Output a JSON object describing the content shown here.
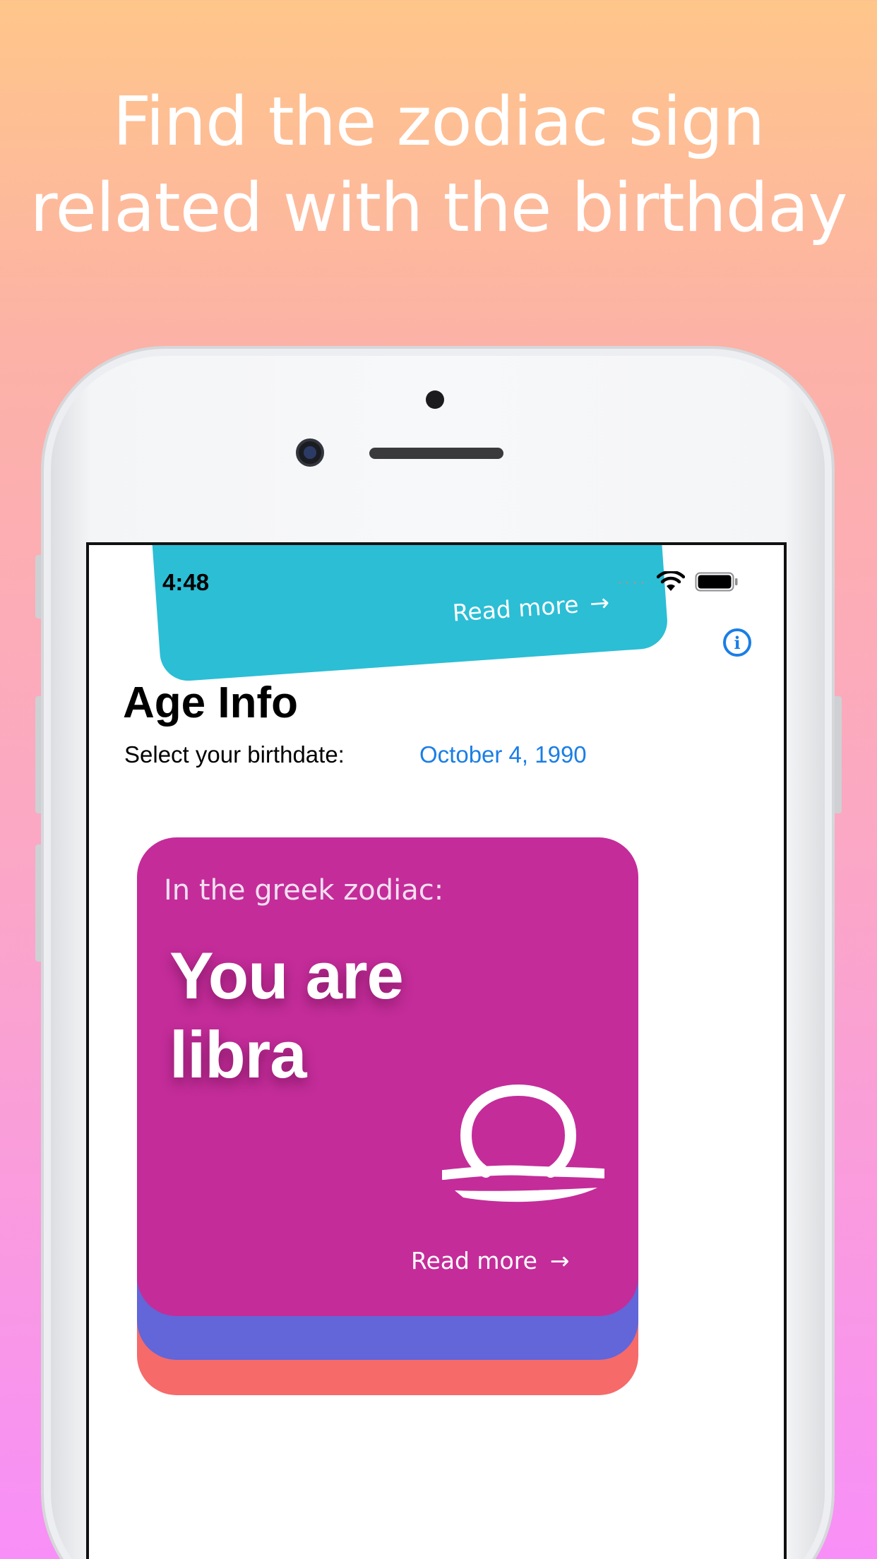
{
  "promo": {
    "headline_line1": "Find the zodiac sign",
    "headline_line2": "related with the birthday"
  },
  "status_bar": {
    "time": "4:48"
  },
  "teal_card": {
    "read_more": "Read more"
  },
  "app": {
    "title": "Age Info",
    "birthdate_label": "Select your birthdate:",
    "birthdate_value": "October 4, 1990"
  },
  "zodiac_card": {
    "subtitle": "In the greek zodiac:",
    "headline_line1": "You are",
    "headline_line2": "libra",
    "read_more": "Read more",
    "icon": "libra-icon"
  },
  "colors": {
    "accent_blue": "#1a7ee6",
    "card_magenta": "#c42c9a",
    "card_blue": "#6266d9",
    "card_red": "#f66a6a",
    "card_teal": "#2bbed5"
  }
}
